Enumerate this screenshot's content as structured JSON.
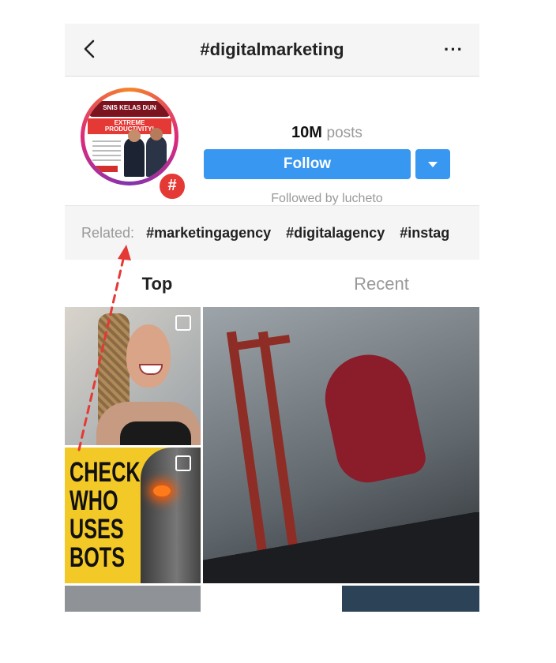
{
  "header": {
    "title": "#digitalmarketing",
    "back_icon": "chevron-left-icon",
    "more_label": "···"
  },
  "profile": {
    "avatar": {
      "banner_text": "SNIS KELAS DUN",
      "headline_line1": "EXTREME",
      "headline_line2": "PRODUCTIVITY!"
    },
    "hashtag_badge": "#",
    "posts_count": "10M",
    "posts_label": "posts",
    "follow_label": "Follow",
    "followed_by": "Followed by lucheto"
  },
  "related": {
    "label": "Related:",
    "tags": [
      "#marketingagency",
      "#digitalagency",
      "#instag"
    ]
  },
  "tabs": {
    "top": "Top",
    "recent": "Recent"
  },
  "grid": {
    "tile3_text": [
      "CHECK",
      "WHO",
      "USES",
      "BOTS"
    ]
  },
  "colors": {
    "accent_blue": "#3897f0",
    "annotation_red": "#e53935"
  }
}
